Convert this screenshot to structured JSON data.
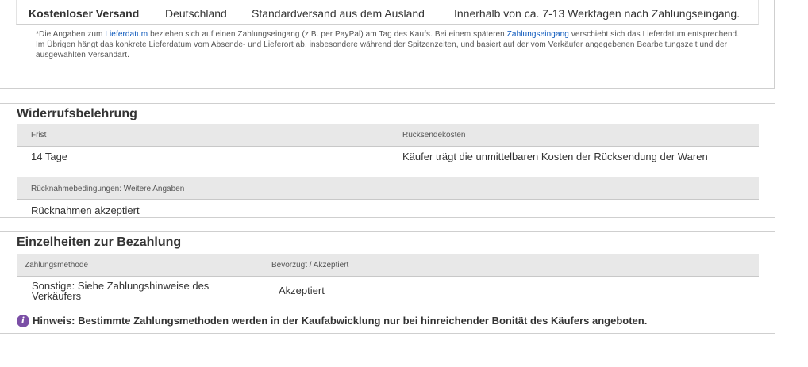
{
  "shipping": {
    "row": {
      "service": "Kostenloser Versand",
      "country": "Deutschland",
      "method": "Standardversand aus dem Ausland",
      "delivery": "Innerhalb von ca. 7-13 Werktagen nach Zahlungseingang."
    },
    "note": {
      "part1": "*Die Angaben zum ",
      "link1": "Lieferdatum",
      "part2": " beziehen sich auf einen Zahlungseingang (z.B. per PayPal) am Tag des Kaufs. Bei einem späteren ",
      "link2": "Zahlungseingang",
      "part3": " verschiebt sich das Lieferdatum entsprechend. Im Übrigen hängt das konkrete Lieferdatum vom Absende- und Lieferort ab, insbesondere während der Spitzenzeiten, und basiert auf der vom Verkäufer angegebenen Bearbeitungszeit und der ausgewählten Versandart."
    }
  },
  "returns": {
    "title": "Widerrufsbelehrung",
    "col1_header": "Frist",
    "col2_header": "Rücksendekosten",
    "col1_value": "14 Tage",
    "col2_value": "Käufer trägt die unmittelbaren Kosten der Rücksendung der Waren",
    "conditions_header": "Rücknahmebedingungen: Weitere Angaben",
    "conditions_value": "Rücknahmen akzeptiert"
  },
  "payment": {
    "title": "Einzelheiten zur Bezahlung",
    "col1_header": "Zahlungsmethode",
    "col2_header": "Bevorzugt / Akzeptiert",
    "method_line1": "Sonstige: Siehe Zahlungshinweise des",
    "method_line2": "Verkäufers",
    "status": "Akzeptiert",
    "hint_icon": "info-icon",
    "hint_icon_glyph": "i",
    "hint": "Hinweis: Bestimmte Zahlungsmethoden werden in der Kaufabwicklung nur bei hinreichender Bonität des Käufers angeboten.",
    "icon_color": "#7b4fa6"
  }
}
